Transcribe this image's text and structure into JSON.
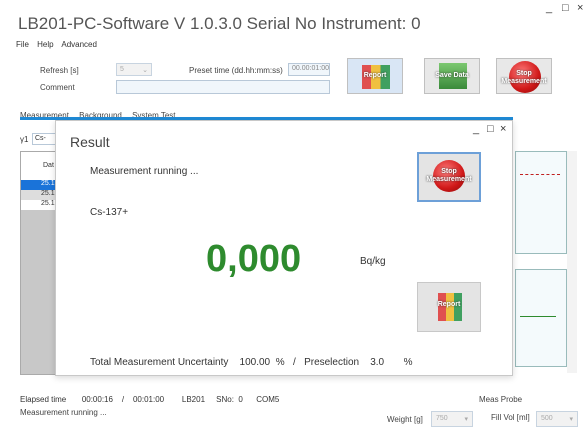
{
  "window": {
    "title": "LB201-PC-Software    V 1.0.3.0    Serial No Instrument:  0",
    "minimize": "_",
    "maximize": "□",
    "close": "×"
  },
  "menu": [
    "File",
    "Help",
    "Advanced"
  ],
  "form": {
    "refresh_label": "Refresh [s]",
    "refresh_value": "5",
    "preset_label": "Preset time (dd.hh:mm:ss)",
    "preset_value": "00.00:01:00",
    "comment_label": "Comment",
    "comment_value": ""
  },
  "toolbar": {
    "report": "Report",
    "save": "Save Data",
    "stop": "Stop\nMeasurement"
  },
  "tabs": [
    "Measurement",
    "Background",
    "System Test"
  ],
  "left": {
    "gamma": "γ1",
    "nuc": "Cs-",
    "dat_header": "Dat",
    "rows": [
      "25.1",
      "25.1",
      "25.1"
    ]
  },
  "dialog": {
    "title": "Result",
    "running": "Measurement running ...",
    "nuclide": "Cs-137+",
    "value": "0,000",
    "unit": "Bq/kg",
    "uncertainty_label": "Total Measurement Uncertainty",
    "uncertainty_value": "100.00",
    "uncertainty_unit": "%",
    "separator": "/",
    "preselection_label": "Preselection",
    "preselection_value": "3.0",
    "preselection_unit": "%",
    "stop_label": "Stop\nMeasurement",
    "report_label": "Report"
  },
  "status": {
    "elapsed_label": "Elapsed time",
    "elapsed": "00:00:16",
    "sep": "/",
    "total": "00:01:00",
    "device": "LB201",
    "sno_label": "SNo:",
    "sno": "0",
    "port": "COM5",
    "meas_probe": "Meas Probe",
    "message": "Measurement running ...",
    "weight_label": "Weight [g]",
    "weight": "750",
    "fillvol_label": "Fill Vol [ml]",
    "fillvol": "500"
  }
}
